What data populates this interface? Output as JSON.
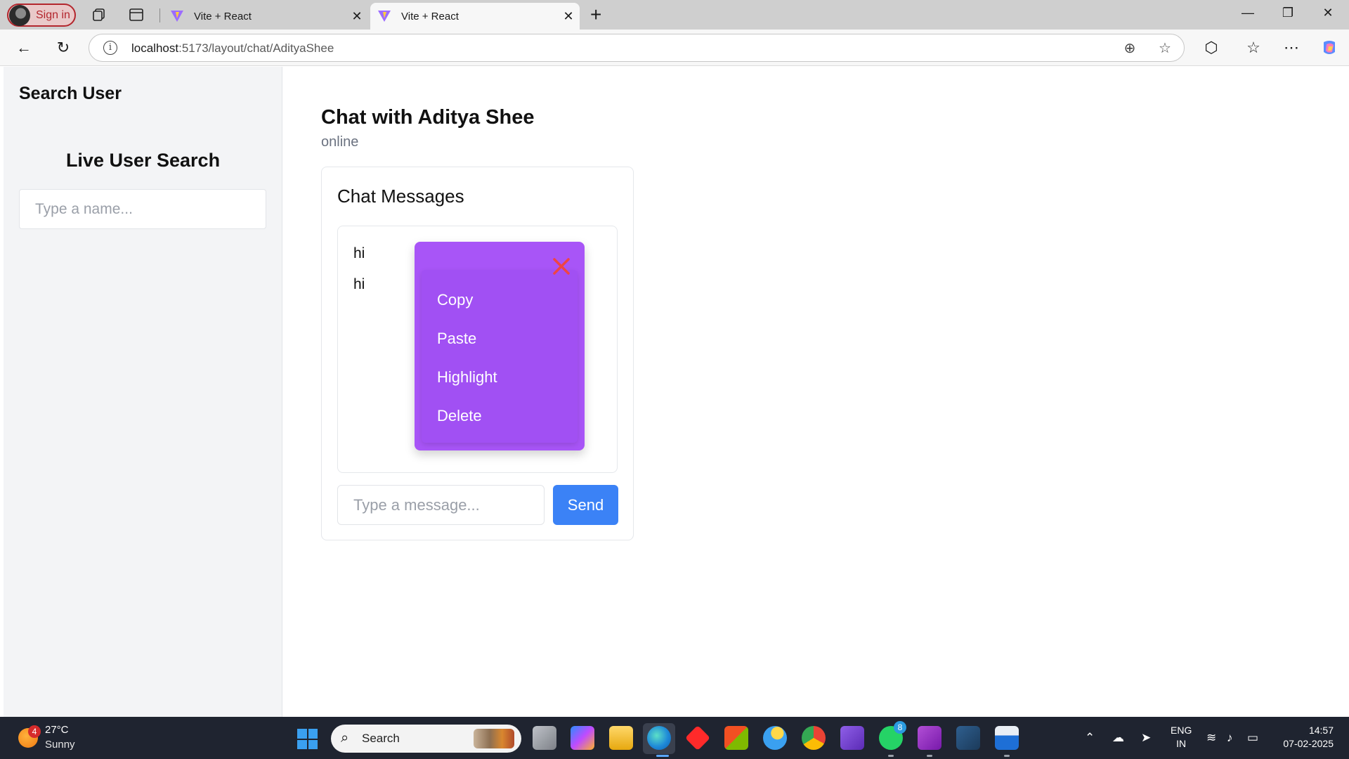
{
  "browser": {
    "signin_label": "Sign in",
    "tabs": [
      {
        "title": "Vite + React",
        "active": false
      },
      {
        "title": "Vite + React",
        "active": true
      }
    ],
    "url_host": "localhost",
    "url_path": ":5173/layout/chat/AdityaShee"
  },
  "sidebar": {
    "heading": "Search User",
    "subheading": "Live User Search",
    "search_placeholder": "Type a name..."
  },
  "chat": {
    "title": "Chat with Aditya Shee",
    "status": "online",
    "panel_title": "Chat Messages",
    "messages": [
      "hi",
      "hi"
    ],
    "input_placeholder": "Type a message...",
    "send_label": "Send"
  },
  "context_menu": {
    "items": [
      "Copy",
      "Paste",
      "Highlight",
      "Delete"
    ],
    "bg_color": "#a855f7",
    "close_color": "#ef4444"
  },
  "taskbar": {
    "weather_badge": "4",
    "temperature": "27°C",
    "condition": "Sunny",
    "search_label": "Search",
    "whatsapp_badge": "8",
    "lang_line1": "ENG",
    "lang_line2": "IN",
    "time": "14:57",
    "date": "07-02-2025"
  },
  "colors": {
    "accent_button": "#3b82f6",
    "sidebar_bg": "#f3f4f6"
  }
}
